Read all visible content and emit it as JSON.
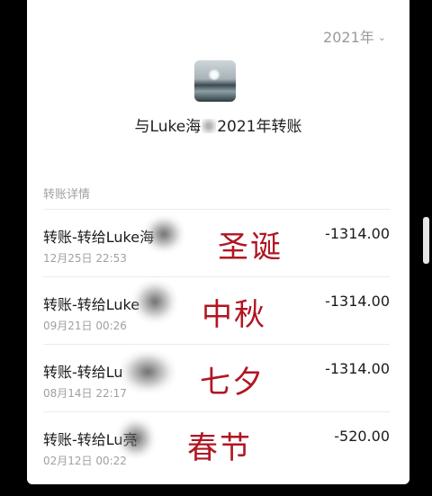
{
  "header": {
    "year_label": "2021年"
  },
  "contact": {
    "title_prefix": "与Luke海",
    "title_suffix": "2021年转账"
  },
  "section": {
    "label": "转账详情"
  },
  "transfers": [
    {
      "name": "转账-转给Luke海",
      "time": "12月25日 22:53",
      "amount": "-1314.00",
      "note": "圣诞"
    },
    {
      "name": "转账-转给Luke",
      "time": "09月21日 00:26",
      "amount": "-1314.00",
      "note": "中秋"
    },
    {
      "name": "转账-转给Lu",
      "time": "08月14日 22:17",
      "amount": "-1314.00",
      "note": "七夕"
    },
    {
      "name": "转账-转给Lu亮",
      "time": "02月12日 00:22",
      "amount": "-520.00",
      "note": "春节"
    }
  ],
  "colors": {
    "annotation": "#b01622",
    "muted": "#a0a0a0"
  }
}
